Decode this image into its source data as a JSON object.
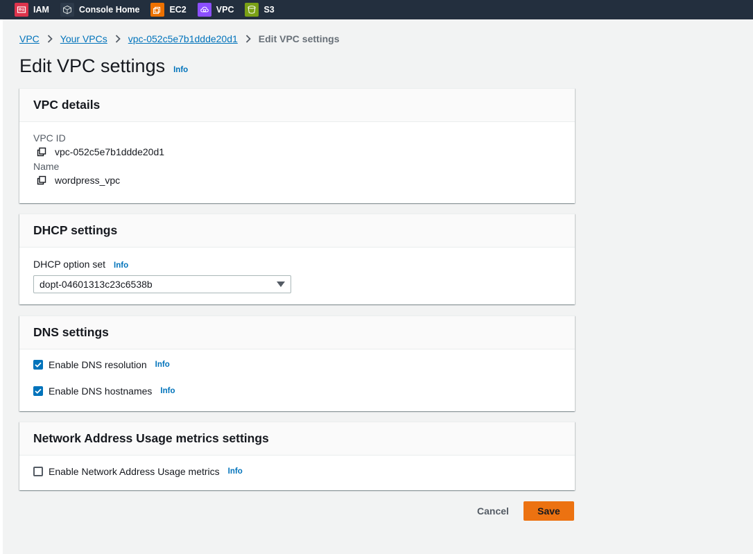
{
  "nav": {
    "services": [
      {
        "label": "IAM",
        "icon": "iam-icon",
        "color": "#dd344c"
      },
      {
        "label": "Console Home",
        "icon": "cube-icon",
        "color": "#2d3a4a"
      },
      {
        "label": "EC2",
        "icon": "ec2-icon",
        "color": "#ed7100"
      },
      {
        "label": "VPC",
        "icon": "vpc-cloud-icon",
        "color": "#8c4fff"
      },
      {
        "label": "S3",
        "icon": "s3-bucket-icon",
        "color": "#7aa116"
      }
    ]
  },
  "breadcrumb": {
    "items": [
      "VPC",
      "Your VPCs",
      "vpc-052c5e7b1ddde20d1"
    ],
    "current": "Edit VPC settings"
  },
  "page": {
    "title": "Edit VPC settings",
    "info": "Info"
  },
  "vpc_details": {
    "title": "VPC details",
    "vpc_id_label": "VPC ID",
    "vpc_id_value": "vpc-052c5e7b1ddde20d1",
    "name_label": "Name",
    "name_value": "wordpress_vpc"
  },
  "dhcp": {
    "title": "DHCP settings",
    "field_label": "DHCP option set",
    "info": "Info",
    "selected": "dopt-04601313c23c6538b"
  },
  "dns": {
    "title": "DNS settings",
    "resolution_label": "Enable DNS resolution",
    "resolution_checked": true,
    "hostnames_label": "Enable DNS hostnames",
    "hostnames_checked": true,
    "info": "Info"
  },
  "nau": {
    "title": "Network Address Usage metrics settings",
    "metrics_label": "Enable Network Address Usage metrics",
    "metrics_checked": false,
    "info": "Info"
  },
  "actions": {
    "cancel": "Cancel",
    "save": "Save"
  },
  "colors": {
    "link": "#0073bb",
    "primary": "#ec7211",
    "nav_bg": "#232f3e"
  }
}
